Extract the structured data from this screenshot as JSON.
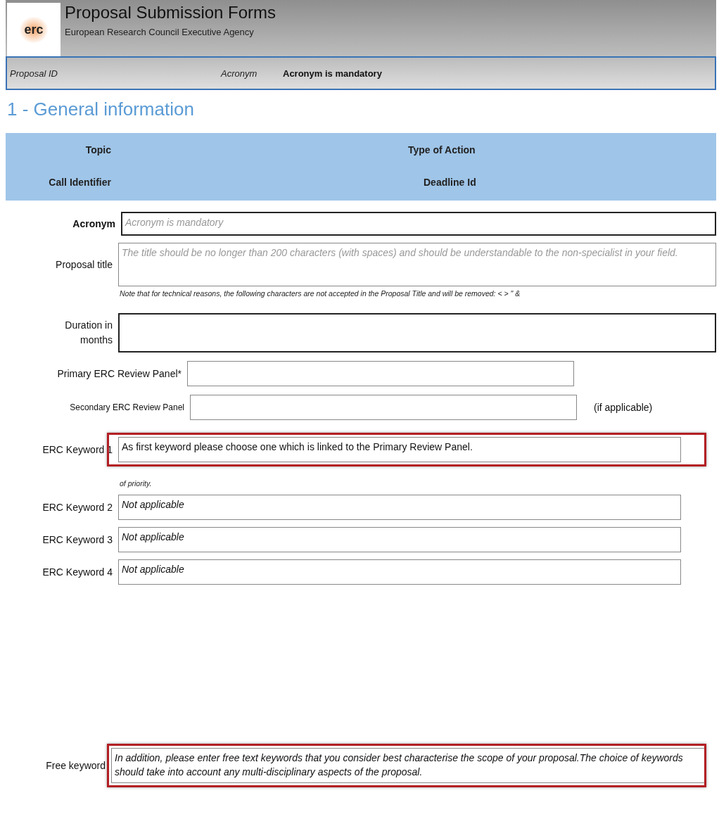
{
  "header": {
    "logo_text": "erc",
    "title": "Proposal Submission Forms",
    "subtitle": "European Research Council Executive Agency"
  },
  "id_bar": {
    "proposal_id_label": "Proposal ID",
    "acronym_label": "Acronym",
    "acronym_value": "Acronym is mandatory"
  },
  "section_title": "1 - General information",
  "info_table": [
    {
      "left": "Topic",
      "right": "Type of Action"
    },
    {
      "left": "Call Identifier",
      "right": "Deadline Id"
    }
  ],
  "fields": [
    {
      "kind": "wide",
      "label": "Acronym",
      "placeholder": "Acronym is mandatory",
      "highlighted": false
    },
    {
      "kind": "area",
      "label": "Proposal title",
      "placeholder": "The title should be no longer than 200 characters (with spaces) and should be understandable to the non-specialist in your field.",
      "note": "Note that for technical reasons, the following characters are not accepted in the Proposal Title and will be removed: < > \" &",
      "highlighted": false
    },
    {
      "kind": "area",
      "label": "Duration in months",
      "highlighted": false
    },
    {
      "kind": "panel",
      "label": "Primary ERC Review Panel*",
      "highlighted": false
    },
    {
      "kind": "panel",
      "label": "Secondary ERC Review Panel",
      "suffix": "(if applicable)",
      "highlighted": false
    },
    {
      "kind": "keyword",
      "label": "ERC Keyword 1",
      "value": "As first keyword please choose one which is linked to the Primary Review Panel.",
      "note": "of priority.",
      "highlighted": true
    },
    {
      "kind": "keyword",
      "label": "ERC Keyword 2",
      "value": "Not applicable",
      "highlighted": false
    },
    {
      "kind": "keyword",
      "label": "ERC Keyword 3",
      "value": "Not applicable",
      "highlighted": false
    },
    {
      "kind": "keyword",
      "label": "ERC Keyword 4",
      "value": "Not applicable",
      "highlighted": false
    },
    {
      "kind": "free",
      "label": "Free keyword",
      "value": "In addition, please enter free text keywords that you consider best characterise the scope of your proposal.The choice of keywords should take into account any multi-disciplinary aspects of the proposal.",
      "highlighted": true
    }
  ]
}
